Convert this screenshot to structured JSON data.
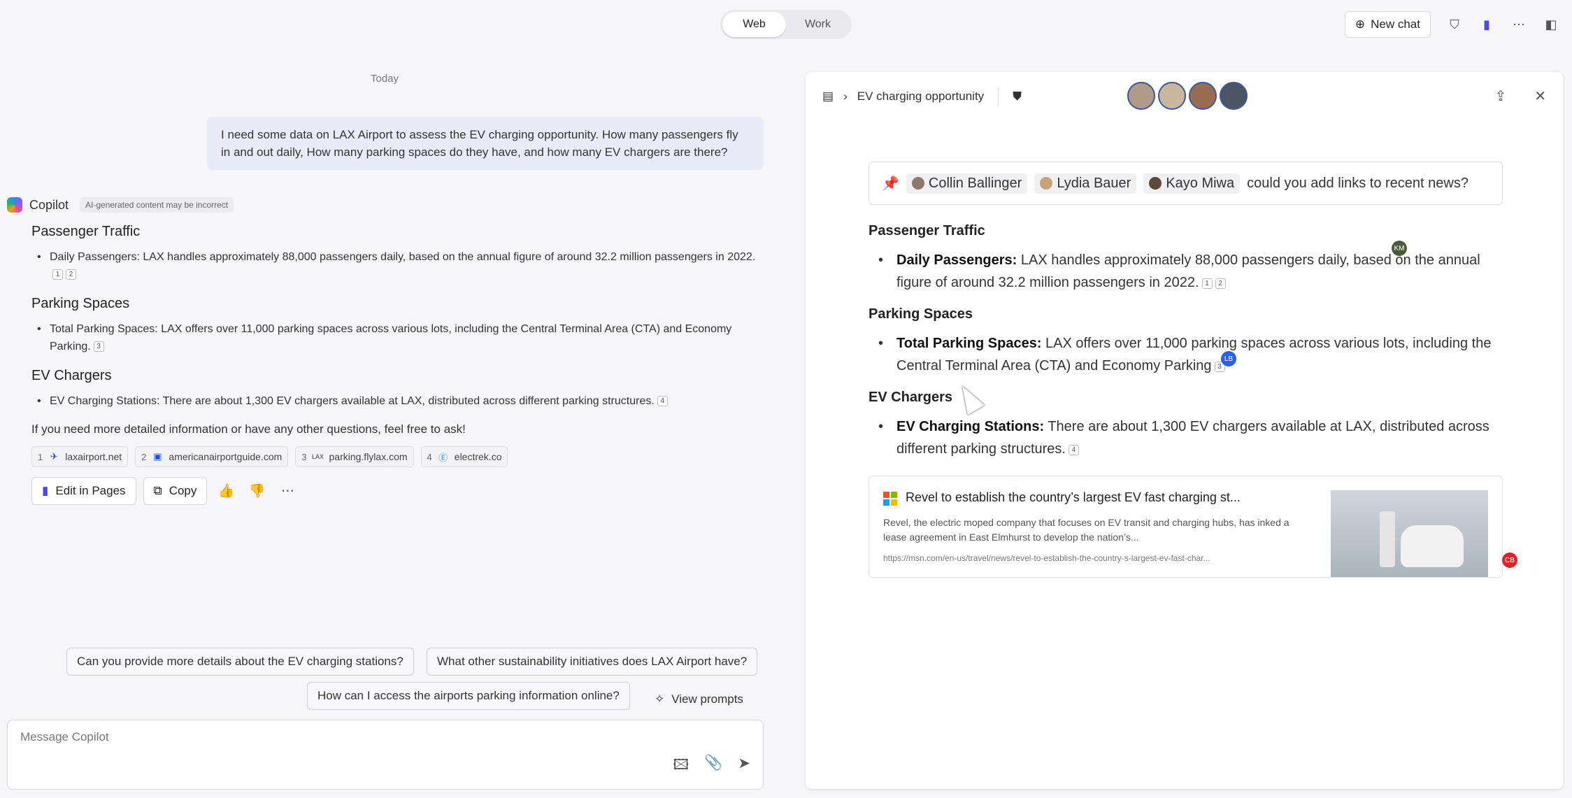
{
  "toggle": {
    "web": "Web",
    "work": "Work"
  },
  "topbar": {
    "new_chat": "New chat"
  },
  "chat": {
    "date": "Today",
    "user_message": "I need some data on LAX Airport to assess the EV charging opportunity. How many passengers fly in and out daily, How many parking spaces do they have, and how many EV chargers are there?",
    "copilot_name": "Copilot",
    "ai_badge": "AI-generated content may be incorrect",
    "sections": [
      {
        "heading": "Passenger Traffic",
        "bullet": "Daily Passengers: LAX handles approximately 88,000 passengers daily, based on the annual figure of around 32.2 million passengers in 2022.",
        "cites": [
          "1",
          "2"
        ]
      },
      {
        "heading": "Parking Spaces",
        "bullet": "Total Parking Spaces: LAX offers over 11,000 parking spaces across various lots, including the Central Terminal Area (CTA) and Economy Parking.",
        "cites": [
          "3"
        ]
      },
      {
        "heading": "EV Chargers",
        "bullet": "EV Charging Stations: There are about 1,300 EV chargers available at LAX, distributed across different parking structures.",
        "cites": [
          "4"
        ]
      }
    ],
    "followup": "If you need more detailed information or have any other questions, feel free to ask!",
    "sources": [
      {
        "num": "1",
        "label": "laxairport.net",
        "icon": "plane-icon"
      },
      {
        "num": "2",
        "label": "americanairportguide.com",
        "icon": "site-icon"
      },
      {
        "num": "3",
        "label": "parking.flylax.com",
        "icon": "lax-icon"
      },
      {
        "num": "4",
        "label": "electrek.co",
        "icon": "e-icon"
      }
    ],
    "actions": {
      "edit": "Edit in Pages",
      "copy": "Copy"
    },
    "suggestions": [
      "Can you provide more details about the EV charging stations?",
      "What other sustainability initiatives does LAX Airport have?",
      "How can I access the airports parking information online?"
    ],
    "view_prompts": "View prompts",
    "composer_placeholder": "Message Copilot"
  },
  "page": {
    "title": "EV charging opportunity",
    "prompt": {
      "mentions": [
        "Collin Ballinger",
        "Lydia Bauer",
        "Kayo Miwa"
      ],
      "text": "could you add links to recent news?"
    },
    "sections": [
      {
        "heading": "Passenger Traffic",
        "label": "Daily Passengers:",
        "text": "LAX handles approximately 88,000 passengers daily, based on the annual figure of around 32.2 million passengers in 2022.",
        "cites": [
          "1",
          "2"
        ]
      },
      {
        "heading": "Parking Spaces",
        "label": "Total Parking Spaces:",
        "text": "LAX offers over 11,000 parking spaces across various lots, including the Central Terminal Area (CTA) and Economy Parking",
        "cites": [
          "3"
        ]
      },
      {
        "heading": "EV Chargers",
        "label": "EV Charging Stations:",
        "text": "There are about 1,300 EV chargers available at LAX, distributed across different parking structures.",
        "cites": [
          "4"
        ]
      }
    ],
    "news": {
      "title": "Revel to establish the country’s largest EV fast charging st...",
      "desc": "Revel, the electric moped company that focuses on EV transit and charging hubs, has inked a lease agreement in East Elmhurst to develop the nation’s...",
      "url": "https://msn.com/en-us/travel/news/revel-to-establish-the-country-s-largest-ev-fast-char..."
    },
    "presence": {
      "km": "KM",
      "lb": "LB",
      "cb": "CB"
    }
  }
}
